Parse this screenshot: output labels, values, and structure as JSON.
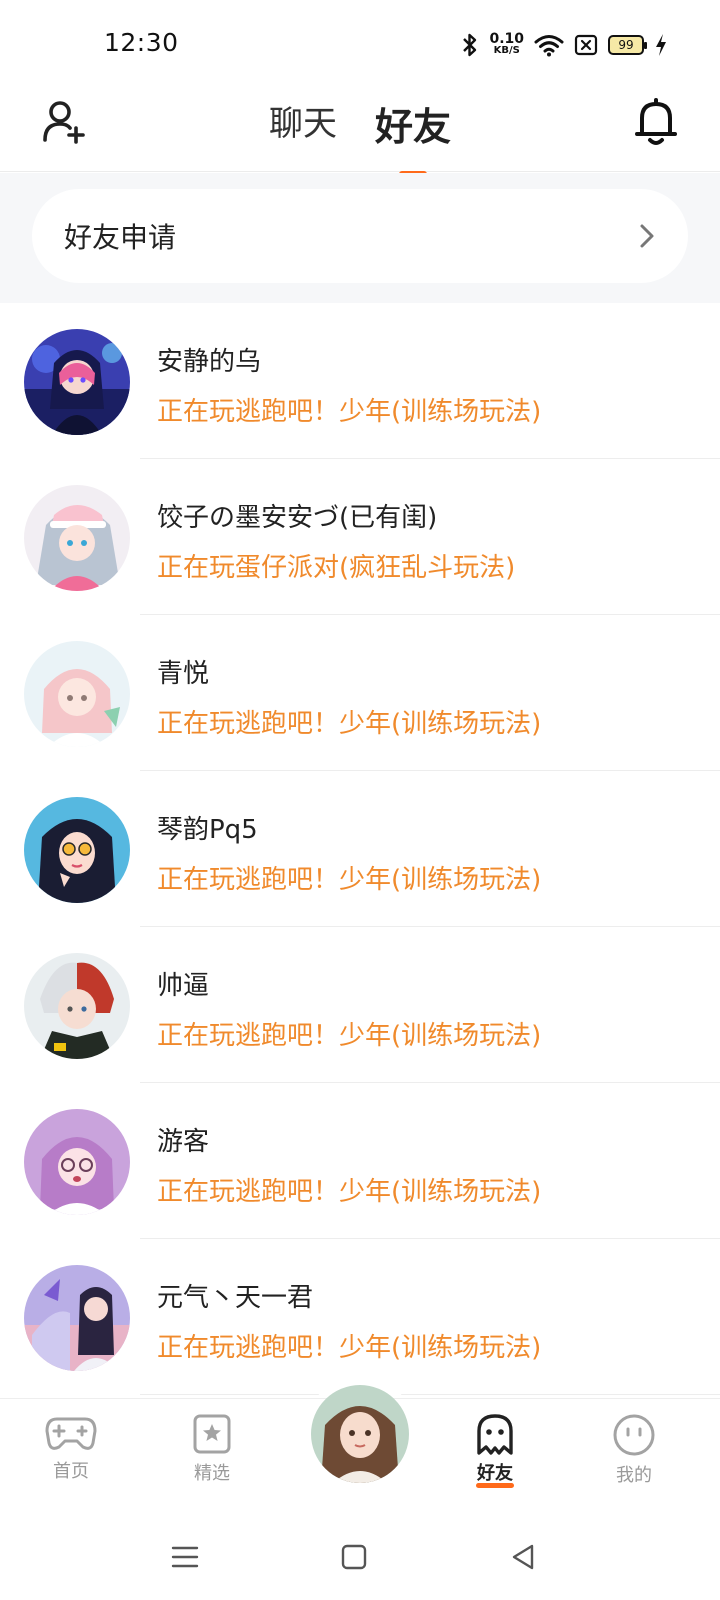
{
  "status_bar": {
    "time": "12:30",
    "speed_value": "0.10",
    "speed_unit": "KB/S",
    "battery": "99"
  },
  "header": {
    "tabs": [
      {
        "label": "聊天",
        "active": false
      },
      {
        "label": "好友",
        "active": true
      }
    ]
  },
  "friend_request": {
    "label": "好友申请"
  },
  "friends": [
    {
      "name": "安静的乌",
      "status": "正在玩逃跑吧！少年(训练场玩法)"
    },
    {
      "name": "饺子の墨安安づ(已有闺)",
      "status": "正在玩蛋仔派对(疯狂乱斗玩法)"
    },
    {
      "name": "青悦",
      "status": "正在玩逃跑吧！少年(训练场玩法)"
    },
    {
      "name": "琴韵Pq5",
      "status": "正在玩逃跑吧！少年(训练场玩法)"
    },
    {
      "name": "帅逼",
      "status": "正在玩逃跑吧！少年(训练场玩法)"
    },
    {
      "name": "游客",
      "status": "正在玩逃跑吧！少年(训练场玩法)"
    },
    {
      "name": "元气丶天一君",
      "status": "正在玩逃跑吧！少年(训练场玩法)"
    }
  ],
  "bottom_nav": {
    "items": [
      {
        "label": "首页",
        "icon": "gamepad-icon"
      },
      {
        "label": "精选",
        "icon": "star-bookmark-icon"
      },
      {
        "label": "好友",
        "icon": "ghost-icon",
        "active": true
      },
      {
        "label": "我的",
        "icon": "face-icon"
      }
    ]
  },
  "colors": {
    "accent": "#ff6a1a",
    "status_text": "#f08a2c",
    "band_bg": "#f6f7f9"
  }
}
